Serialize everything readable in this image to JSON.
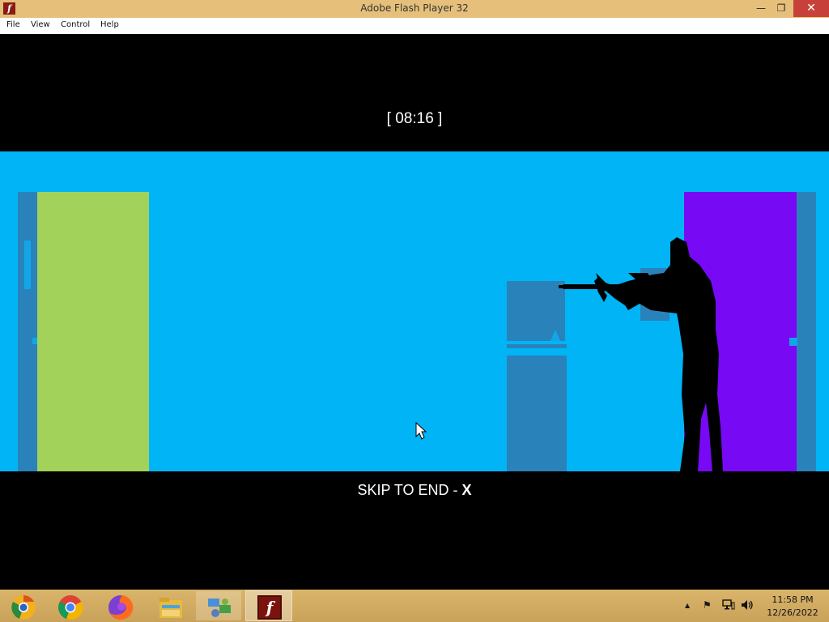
{
  "window": {
    "title": "Adobe Flash Player 32",
    "icon": "flash-icon",
    "minimize_glyph": "—",
    "maximize_glyph": "❐",
    "close_glyph": "✕"
  },
  "menu": {
    "items": [
      {
        "label": "File"
      },
      {
        "label": "View"
      },
      {
        "label": "Control"
      },
      {
        "label": "Help"
      }
    ]
  },
  "game": {
    "timer": "[ 08:16 ]",
    "skip_prefix": "SKIP TO END - ",
    "skip_key": "X",
    "colors": {
      "sky": "#00b4f5",
      "left_door": "#a2d25a",
      "right_door": "#7709f5",
      "wall_panel": "#2a82bb",
      "silhouette": "#000000"
    }
  },
  "taskbar": {
    "apps": [
      {
        "name": "chrome-canary-icon"
      },
      {
        "name": "chrome-icon"
      },
      {
        "name": "firefox-icon"
      },
      {
        "name": "file-explorer-icon"
      },
      {
        "name": "network-app-icon"
      },
      {
        "name": "flash-player-icon"
      }
    ],
    "tray": {
      "show_hidden": "▲",
      "flag": "⚑",
      "volume": "🔊"
    },
    "clock": {
      "time": "11:58 PM",
      "date": "12/26/2022"
    }
  }
}
